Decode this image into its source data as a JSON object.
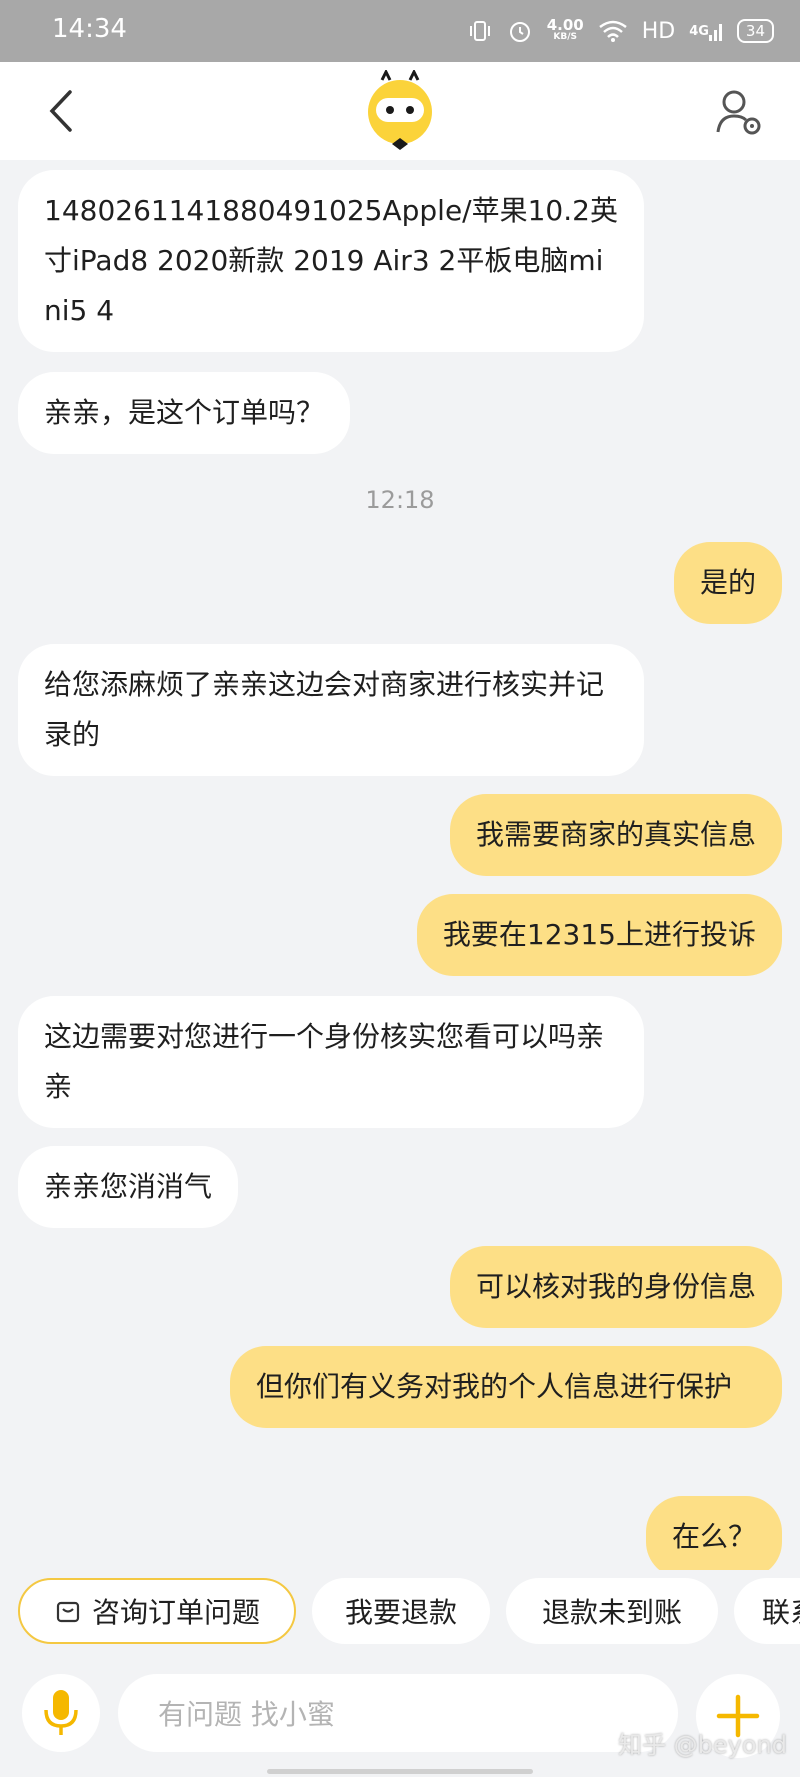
{
  "status_bar": {
    "time": "14:34",
    "net_speed_value": "4.00",
    "net_speed_unit": "KB/S",
    "hd_label": "HD",
    "network_label": "4G",
    "battery_level": "34",
    "icons": [
      "vibrate-icon",
      "alarm-icon",
      "wifi-icon",
      "signal-icon"
    ]
  },
  "header": {
    "back_icon": "chevron-left-icon",
    "logo_icon": "mascot-logo",
    "profile_icon": "user-settings-icon"
  },
  "messages": [
    {
      "from": "agent",
      "text": "1480261141880491025Apple/苹果10.2英寸iPad8 2020新款 2019 Air3 2平板电脑mini5 4"
    },
    {
      "from": "agent",
      "text": "亲亲，是这个订单吗？"
    },
    {
      "type": "timestamp",
      "text": "12:18"
    },
    {
      "from": "user",
      "text": "是的"
    },
    {
      "from": "agent",
      "text": "给您添麻烦了亲亲这边会对商家进行核实并记录的"
    },
    {
      "from": "user",
      "text": "我需要商家的真实信息"
    },
    {
      "from": "user",
      "text": "我要在12315上进行投诉"
    },
    {
      "from": "agent",
      "text": "这边需要对您进行一个身份核实您看可以吗亲亲"
    },
    {
      "from": "agent",
      "text": "亲亲您消消气"
    },
    {
      "from": "user",
      "text": "可以核对我的身份信息"
    },
    {
      "from": "user",
      "text": "但你们有义务对我的个人信息进行保护"
    },
    {
      "from": "user",
      "text": "在么？"
    }
  ],
  "quick_replies": [
    {
      "label": "咨询订单问题",
      "icon": "order-bag-icon"
    },
    {
      "label": "我要退款"
    },
    {
      "label": "退款未到账"
    },
    {
      "label": "联系"
    }
  ],
  "input": {
    "placeholder": "有问题 找小蜜",
    "mic_icon": "microphone-icon",
    "plus_icon": "plus-icon"
  },
  "watermark": "知乎 @beyond",
  "colors": {
    "user_bubble": "#fddf86",
    "agent_bubble": "#ffffff",
    "background": "#f2f3f5",
    "accent": "#f4c842"
  }
}
